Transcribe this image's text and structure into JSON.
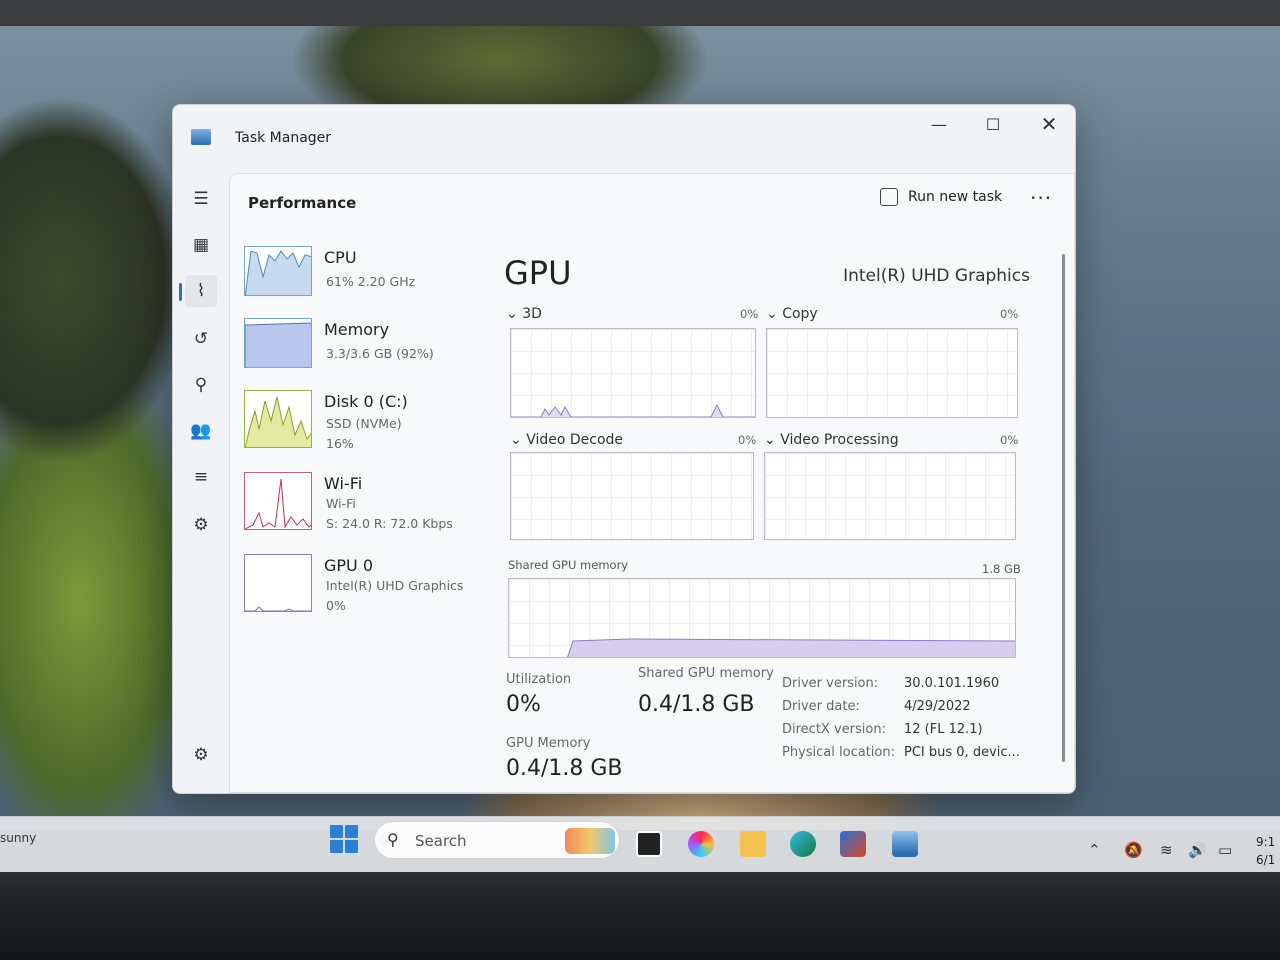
{
  "window": {
    "app_title": "Task Manager",
    "minimize": "—",
    "maximize": "☐",
    "close": "✕"
  },
  "header": {
    "title": "Performance",
    "run_new_task": "Run new task",
    "more": "···"
  },
  "sidebar": {
    "items": [
      {
        "title": "CPU",
        "sub1": "61%  2.20 GHz",
        "sub2": "",
        "sub3": ""
      },
      {
        "title": "Memory",
        "sub1": "3.3/3.6 GB (92%)",
        "sub2": "",
        "sub3": ""
      },
      {
        "title": "Disk 0 (C:)",
        "sub1": "SSD (NVMe)",
        "sub2": "16%",
        "sub3": ""
      },
      {
        "title": "Wi-Fi",
        "sub1": "Wi-Fi",
        "sub2": "S: 24.0  R: 72.0 Kbps",
        "sub3": ""
      },
      {
        "title": "GPU 0",
        "sub1": "Intel(R) UHD Graphics",
        "sub2": "0%",
        "sub3": ""
      }
    ]
  },
  "main": {
    "title": "GPU",
    "model": "Intel(R) UHD Graphics",
    "engines": [
      {
        "name": "3D",
        "pct": "0%"
      },
      {
        "name": "Copy",
        "pct": "0%"
      },
      {
        "name": "Video Decode",
        "pct": "0%"
      },
      {
        "name": "Video Processing",
        "pct": "0%"
      }
    ],
    "shared_mem_label": "Shared GPU memory",
    "shared_mem_max": "1.8 GB",
    "utilization_label": "Utilization",
    "utilization_value": "0%",
    "shared_label": "Shared GPU memory",
    "shared_value": "0.4/1.8 GB",
    "gpu_memory_label": "GPU Memory",
    "gpu_memory_value": "0.4/1.8 GB",
    "info": [
      {
        "key": "Driver version:",
        "val": "30.0.101.1960"
      },
      {
        "key": "Driver date:",
        "val": "4/29/2022"
      },
      {
        "key": "DirectX version:",
        "val": "12 (FL 12.1)"
      },
      {
        "key": "Physical location:",
        "val": "PCI bus 0, devic..."
      }
    ]
  },
  "taskbar": {
    "weather": "sunny",
    "search_text": "Search",
    "clock_time": "9:1",
    "clock_date": "6/1"
  }
}
